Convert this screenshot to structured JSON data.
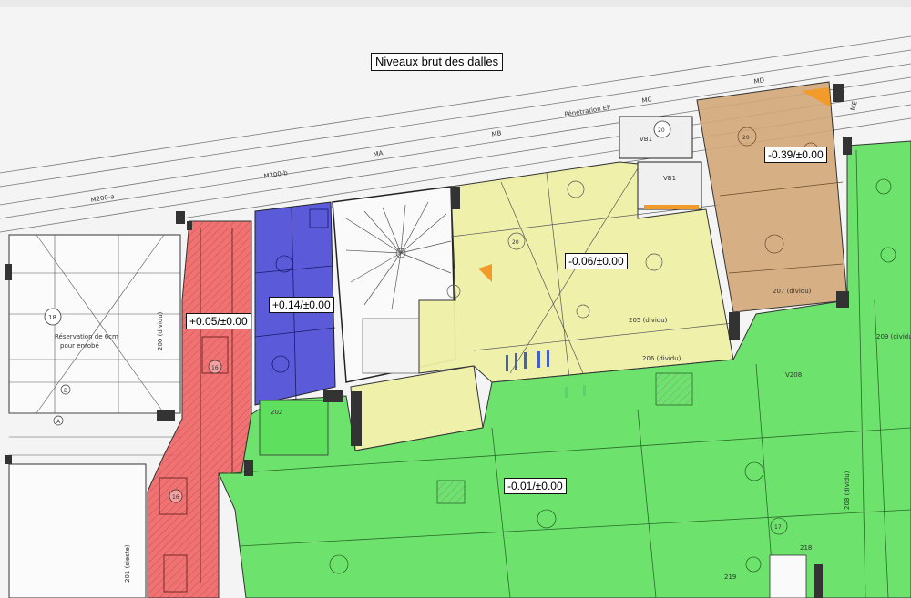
{
  "title": "Niveaux brut des dalles",
  "zones": [
    {
      "id": "red",
      "label": "+0.05/±0.00",
      "color": "#ee5a5a"
    },
    {
      "id": "blue",
      "label": "+0.14/±0.00",
      "color": "#4a4ad6"
    },
    {
      "id": "yellow",
      "label": "-0.06/±0.00",
      "color": "#eef0a6"
    },
    {
      "id": "brown",
      "label": "-0.39/±0.00",
      "color": "#d3a878"
    },
    {
      "id": "green",
      "label": "-0.01/±0.00",
      "color": "#5ee05e"
    }
  ],
  "plan_text": {
    "reservation": "Réservation de 6cm",
    "reservation2": "pour enrobé",
    "penetration": "Pénétration EP",
    "axis_ma": "MA",
    "axis_mb": "MB",
    "axis_mc": "MC",
    "axis_md": "MD",
    "axis_me": "ME",
    "axis_m200b": "M200-b",
    "axis_m200a": "M200-a",
    "room_18": "18",
    "room_200": "200 (dividu)",
    "room_201": "201 (sieste)",
    "room_202": "202",
    "room_205": "205 (dividu)",
    "room_206": "206 (dividu)",
    "room_207": "207 (dividu)",
    "room_208": "208 (dividu)",
    "room_209": "209 (dividu)",
    "room_218": "218",
    "room_219": "219",
    "v208": "V208",
    "vb1": "VB1",
    "circle_20": "20",
    "circle_16": "16",
    "circle_17": "17",
    "circle_b": "B",
    "circle_a": "A"
  }
}
